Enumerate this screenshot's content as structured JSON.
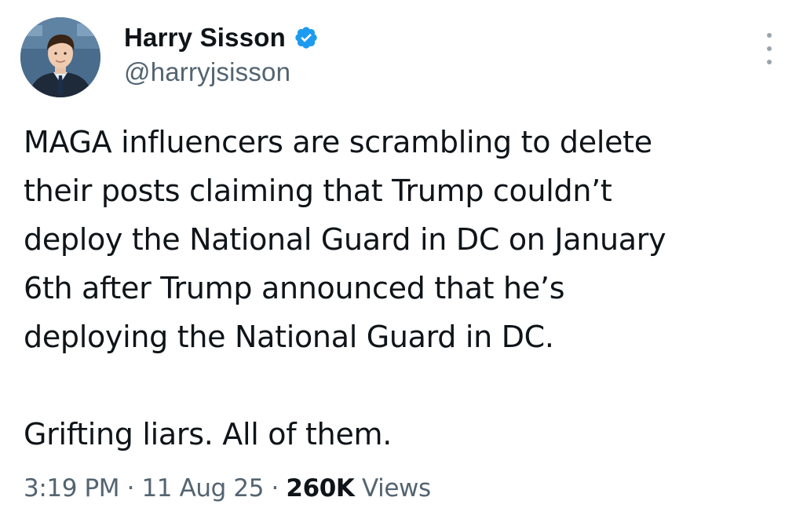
{
  "author": {
    "display_name": "Harry Sisson",
    "handle": "@harryjsisson",
    "verified": true,
    "avatar_icon": "profile-photo"
  },
  "tweet": {
    "paragraphs": [
      "MAGA influencers are scrambling to delete\ntheir posts claiming that Trump couldn’t\ndeploy the National Guard in DC on January\n6th after Trump announced that he’s\ndeploying the National Guard in DC.",
      "Grifting liars. All of them."
    ]
  },
  "meta": {
    "time": "3:19 PM",
    "separator": " · ",
    "date": "11 Aug 25",
    "views_count": "260K",
    "views_label": " Views"
  },
  "colors": {
    "text_primary": "#0f1419",
    "text_secondary": "#536471",
    "verified_blue": "#1d9bf0",
    "background": "#ffffff"
  },
  "icons": {
    "verified": "verified-badge-icon",
    "more": "more-options-icon"
  }
}
